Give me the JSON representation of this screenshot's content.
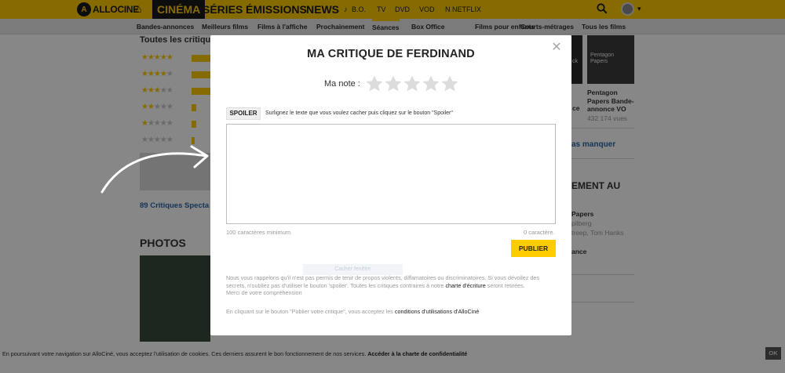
{
  "topnav": {
    "logo_text": "ALLOCINE",
    "home_icon": "home-icon",
    "active": "CINÉMA",
    "items": [
      "SÉRIES",
      "ÉMISSIONS",
      "NEWS"
    ],
    "small_items": [
      "B.O.",
      "TV",
      "DVD",
      "VOD",
      "NETFLIX"
    ],
    "accent": "#fecc00"
  },
  "subnav": {
    "items": [
      "Bandes-annonces",
      "Meilleurs films",
      "Films à l'affiche",
      "Prochainement",
      "Séances",
      "Box Office",
      "Films pour enfants",
      "Courts-métrages",
      "Tous les films"
    ],
    "active_index": 4
  },
  "background": {
    "section_title": "Toutes les critique",
    "critiques_link": "89 Critiques Specta",
    "photos_title": "PHOTOS",
    "right_col": {
      "thumb_label_1": "ck",
      "thumb_label_2": "Pentagon Papers",
      "video_title_1": "ce",
      "video_title_2": "Pentagon Papers Bande-annonce VO",
      "views": "432 174 vues",
      "missed_link": "as manquer",
      "section_heading": "EMENT AU",
      "film_1": "Papers",
      "film_1_meta_1": "pilberg",
      "film_1_meta_2": "treep, Tom Hanks",
      "film_2": "ance"
    }
  },
  "modal": {
    "title": "MA CRITIQUE DE FERDINAND",
    "rating_label": "Ma note :",
    "stars_total": 5,
    "stars_selected": 0,
    "spoiler_label": "SPOILER",
    "spoiler_hint": "Surlignez le texte que vous voulez cacher puis cliquez sur le bouton \"Spoiler\"",
    "review_value": "",
    "min_chars": "100 caractères minimum",
    "char_count": "0 caractère.",
    "publish_label": "PUBLIER",
    "faded_label": "Cacher fenêtre",
    "legal_1": "Nous vous rappelons qu'il n'est pas permis de tenir de propos violents, diffamatoires ou discriminatoires. Si vous dévoilez des secrets, n'oubliez pas d'utiliser le bouton 'spoiler'. Toutes les critiques contraires à notre ",
    "legal_link": "charte d'écriture",
    "legal_2": " seront retirées.",
    "legal_3": "Merci de votre compréhension",
    "consent_1": "En cliquant sur le bouton \"Publier votre critique\", vous acceptez les ",
    "consent_link": "conditions d'utilisations d'AlloCiné"
  },
  "cookie": {
    "text": "En poursuivant votre navigation sur AlloCiné, vous acceptez l'utilisation de cookies. Ces derniers assurent le bon fonctionnement de nos services. ",
    "link": "Accéder à la charte de confidentialité",
    "ok": "OK"
  }
}
